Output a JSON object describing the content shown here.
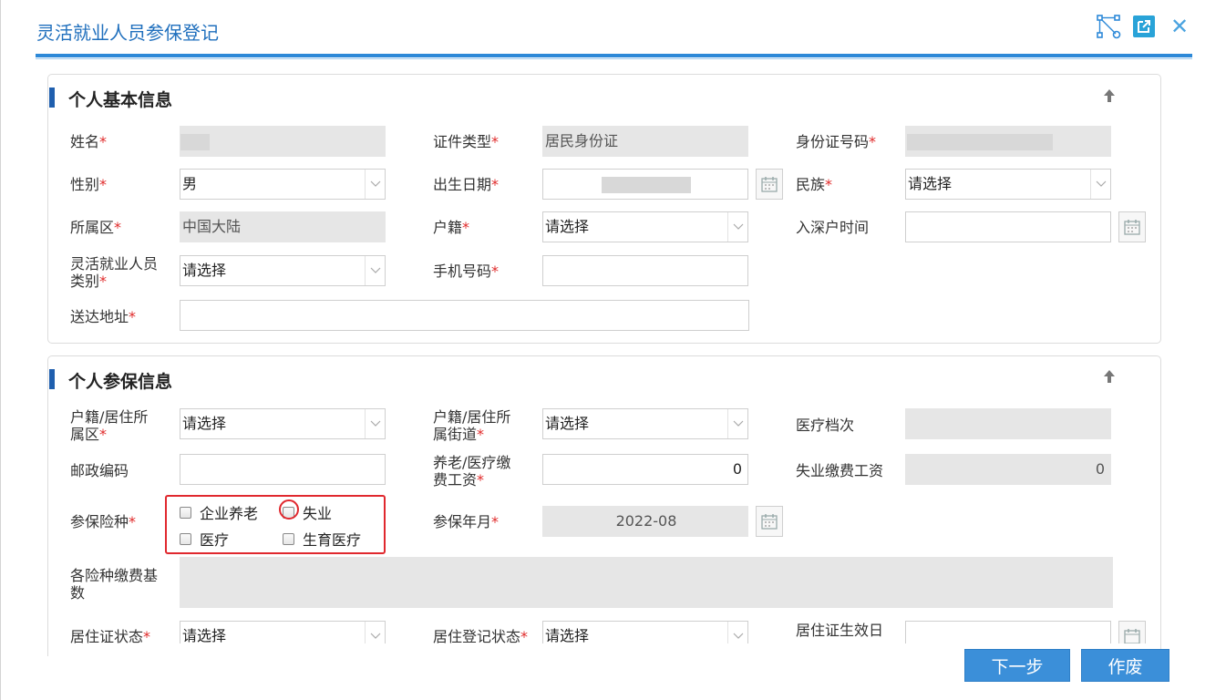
{
  "dialog": {
    "title": "灵活就业人员参保登记",
    "close_glyph": "✕"
  },
  "basic_info": {
    "section_title": "个人基本信息",
    "name_label": "姓名",
    "id_type_label": "证件类型",
    "id_type_value": "居民身份证",
    "id_number_label": "身份证号码",
    "gender_label": "性别",
    "gender_value": "男",
    "birth_date_label": "出生日期",
    "ethnicity_label": "民族",
    "ethnicity_value": "请选择",
    "district_label": "所属区",
    "district_value": "中国大陆",
    "hukou_label": "户籍",
    "hukou_value": "请选择",
    "settle_date_label": "入深户时间",
    "category_label_1": "灵活就业人员",
    "category_label_2": "类别",
    "category_value": "请选择",
    "mobile_label": "手机号码",
    "address_label": "送达地址",
    "required_mark": "*"
  },
  "insurance_info": {
    "section_title": "个人参保信息",
    "residence_district_label_1": "户籍/居住所",
    "residence_district_label_2": "属区",
    "residence_district_value": "请选择",
    "residence_street_label_1": "户籍/居住所",
    "residence_street_label_2": "属街道",
    "residence_street_value": "请选择",
    "medical_level_label": "医疗档次",
    "postal_code_label": "邮政编码",
    "pension_wage_label_1": "养老/医疗缴",
    "pension_wage_label_2": "费工资",
    "pension_wage_value": "0",
    "unemployment_wage_label": "失业缴费工资",
    "unemployment_wage_value": "0",
    "insurance_types_label": "参保险种",
    "insurance_types": [
      {
        "label": "企业养老",
        "checked": false
      },
      {
        "label": "失业",
        "checked": false
      },
      {
        "label": "医疗",
        "checked": false
      },
      {
        "label": "生育医疗",
        "checked": false
      }
    ],
    "insured_month_label": "参保年月",
    "insured_month_value": "2022-08",
    "base_label_1": "各险种缴费基",
    "base_label_2": "数",
    "residence_permit_status_label": "居住证状态",
    "residence_permit_status_value": "请选择",
    "residence_reg_status_label": "居住登记状态",
    "residence_reg_status_value": "请选择",
    "permit_effective_date_label": "居住证生效日"
  },
  "footer": {
    "next_label": "下一步",
    "void_label": "作废"
  },
  "colors": {
    "accent": "#2d89d8",
    "title_text": "#1f6fbd",
    "required": "#e02a2a",
    "highlight_box": "#e0282e",
    "button": "#3b8fd9"
  }
}
